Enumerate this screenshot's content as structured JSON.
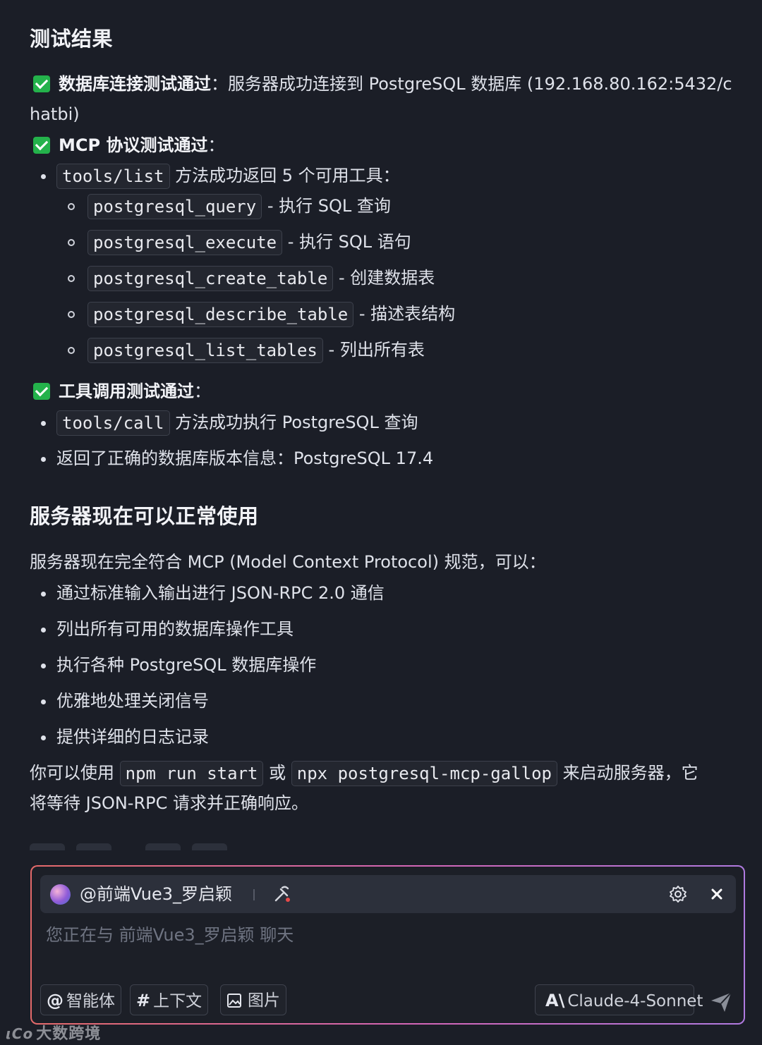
{
  "result_section": {
    "title": "测试结果",
    "db_test": {
      "label": "数据库连接测试通过",
      "colon": "：",
      "text_line1": "服务器成功连接到 PostgreSQL 数据库 (192.168.80.162:5432/c",
      "text_line2": "hatbi)"
    },
    "mcp_test": {
      "label": "MCP 协议测试通过",
      "colon": "：",
      "list_code": "tools/list",
      "list_text": "方法成功返回 5 个可用工具：",
      "tools": [
        {
          "code": "postgresql_query",
          "desc": "- 执行 SQL 查询"
        },
        {
          "code": "postgresql_execute",
          "desc": "- 执行 SQL 语句"
        },
        {
          "code": "postgresql_create_table",
          "desc": "- 创建数据表"
        },
        {
          "code": "postgresql_describe_table",
          "desc": "- 描述表结构"
        },
        {
          "code": "postgresql_list_tables",
          "desc": "- 列出所有表"
        }
      ]
    },
    "tool_test": {
      "label": "工具调用测试通过",
      "colon": "：",
      "call_code": "tools/call",
      "call_text": "方法成功执行 PostgreSQL 查询",
      "version_text": "返回了正确的数据库版本信息：PostgreSQL 17.4"
    }
  },
  "usable_section": {
    "title": "服务器现在可以正常使用",
    "intro": "服务器现在完全符合 MCP (Model Context Protocol) 规范，可以：",
    "items": [
      "通过标准输入输出进行 JSON-RPC 2.0 通信",
      "列出所有可用的数据库操作工具",
      "执行各种 PostgreSQL 数据库操作",
      "优雅地处理关闭信号",
      "提供详细的日志记录"
    ],
    "closing_prefix": "你可以使用",
    "closing_code1": "npm run start",
    "closing_or": "或",
    "closing_code2": "npx postgresql-mcp-gallop",
    "closing_suffix": "来启动服务器，它",
    "closing_line2": "将等待 JSON-RPC 请求并正确响应。"
  },
  "input_panel": {
    "agent_name": "@前端Vue3_罗启颖",
    "placeholder": "您正在与 前端Vue3_罗启颖 聊天",
    "chip_agent": {
      "icon": "@",
      "label": "智能体"
    },
    "chip_context": {
      "icon": "#",
      "label": "上下文"
    },
    "chip_image": {
      "label": "图片"
    },
    "model": {
      "icon": "A\\",
      "label": "Claude-4-Sonnet"
    },
    "accent_gradient": [
      "#e46a6a",
      "#d266b8",
      "#b07ae0"
    ]
  },
  "watermark": {
    "logo": "ιCo",
    "text": "大数跨境"
  },
  "colors": {
    "background": "#1b1e27",
    "check_green": "#24b24b",
    "code_bg": "#23262f"
  }
}
